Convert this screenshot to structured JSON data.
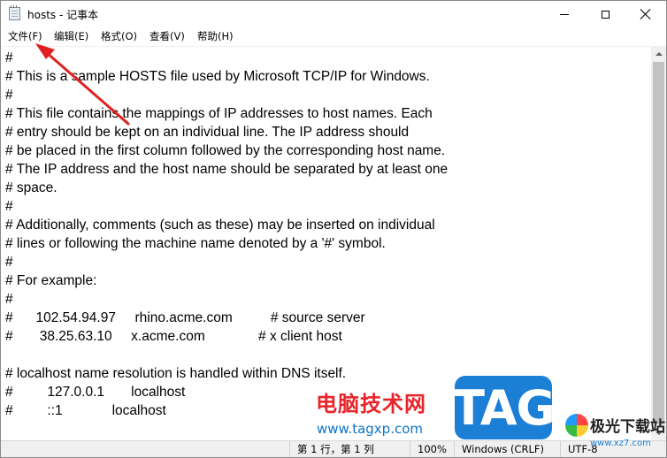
{
  "window": {
    "title": "hosts - 记事本",
    "icon": "notepad-icon"
  },
  "controls": {
    "minimize_icon": "minimize-icon",
    "maximize_icon": "maximize-icon",
    "close_icon": "close-icon"
  },
  "menu": [
    {
      "label": "文件(F)"
    },
    {
      "label": "编辑(E)"
    },
    {
      "label": "格式(O)"
    },
    {
      "label": "查看(V)"
    },
    {
      "label": "帮助(H)"
    }
  ],
  "document": {
    "text": "#\n# This is a sample HOSTS file used by Microsoft TCP/IP for Windows.\n#\n# This file contains the mappings of IP addresses to host names. Each\n# entry should be kept on an individual line. The IP address should\n# be placed in the first column followed by the corresponding host name.\n# The IP address and the host name should be separated by at least one\n# space.\n#\n# Additionally, comments (such as these) may be inserted on individual\n# lines or following the machine name denoted by a '#' symbol.\n#\n# For example:\n#\n#      102.54.94.97     rhino.acme.com          # source server\n#       38.25.63.10     x.acme.com              # x client host\n\n# localhost name resolution is handled within DNS itself.\n#\t127.0.0.1       localhost\n#\t::1             localhost"
  },
  "status": {
    "position": "第 1 行，第 1 列",
    "zoom": "100%",
    "line_ending": "Windows (CRLF)",
    "encoding": "UTF-8"
  },
  "watermark": {
    "site_name": "电脑技术网",
    "site_url": "www.tagxp.com",
    "logo_text": "TAG",
    "second_site_name": "极光下载站",
    "second_site_url": "www.xz7.com"
  },
  "colors": {
    "arrow": "#e02020",
    "watermark_red": "#e8242a",
    "watermark_blue": "#1b7fd6"
  }
}
